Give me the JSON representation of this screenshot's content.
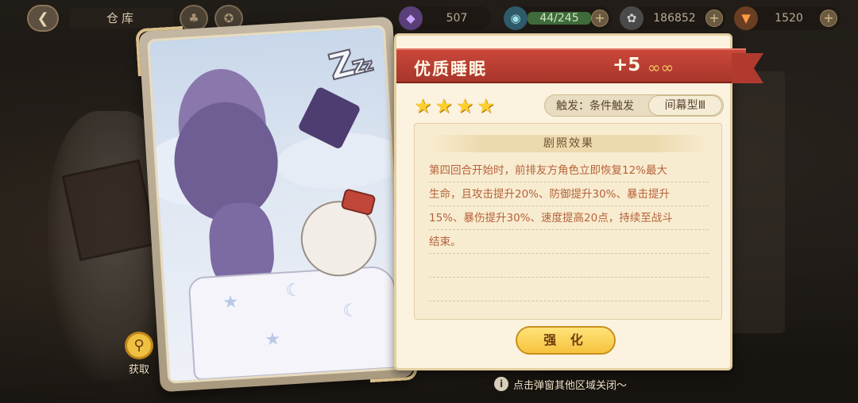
{
  "topbar": {
    "title": "仓库",
    "resources": [
      {
        "icon": "crystal-icon",
        "value": "507"
      },
      {
        "icon": "stamina-icon",
        "value": "44/245"
      },
      {
        "icon": "coin-icon",
        "value": "186852"
      },
      {
        "icon": "carrot-icon",
        "value": "1520"
      }
    ]
  },
  "card": {
    "name": "优质睡眠",
    "level": "+5",
    "stars": 4,
    "trigger": "触发：条件触发",
    "type": "间幕型Ⅲ",
    "effect_header": "剧照效果",
    "effect_lines": [
      "第四回合开始时，前排友方角色立即恢复12%最大",
      "生命，且攻击提升20%、防御提升30%、暴击提升",
      "15%、暴伤提升30%、速度提高20点，持续至战斗",
      "结束。",
      "",
      ""
    ],
    "enhance_label": "强 化"
  },
  "acquire_label": "获取",
  "hint": "点击弹窗其他区域关闭～",
  "colors": {
    "ribbon": "#c9473a",
    "panel_bg": "#fbf3df",
    "effect_text": "#b5623a",
    "button": "#f6c23e"
  }
}
